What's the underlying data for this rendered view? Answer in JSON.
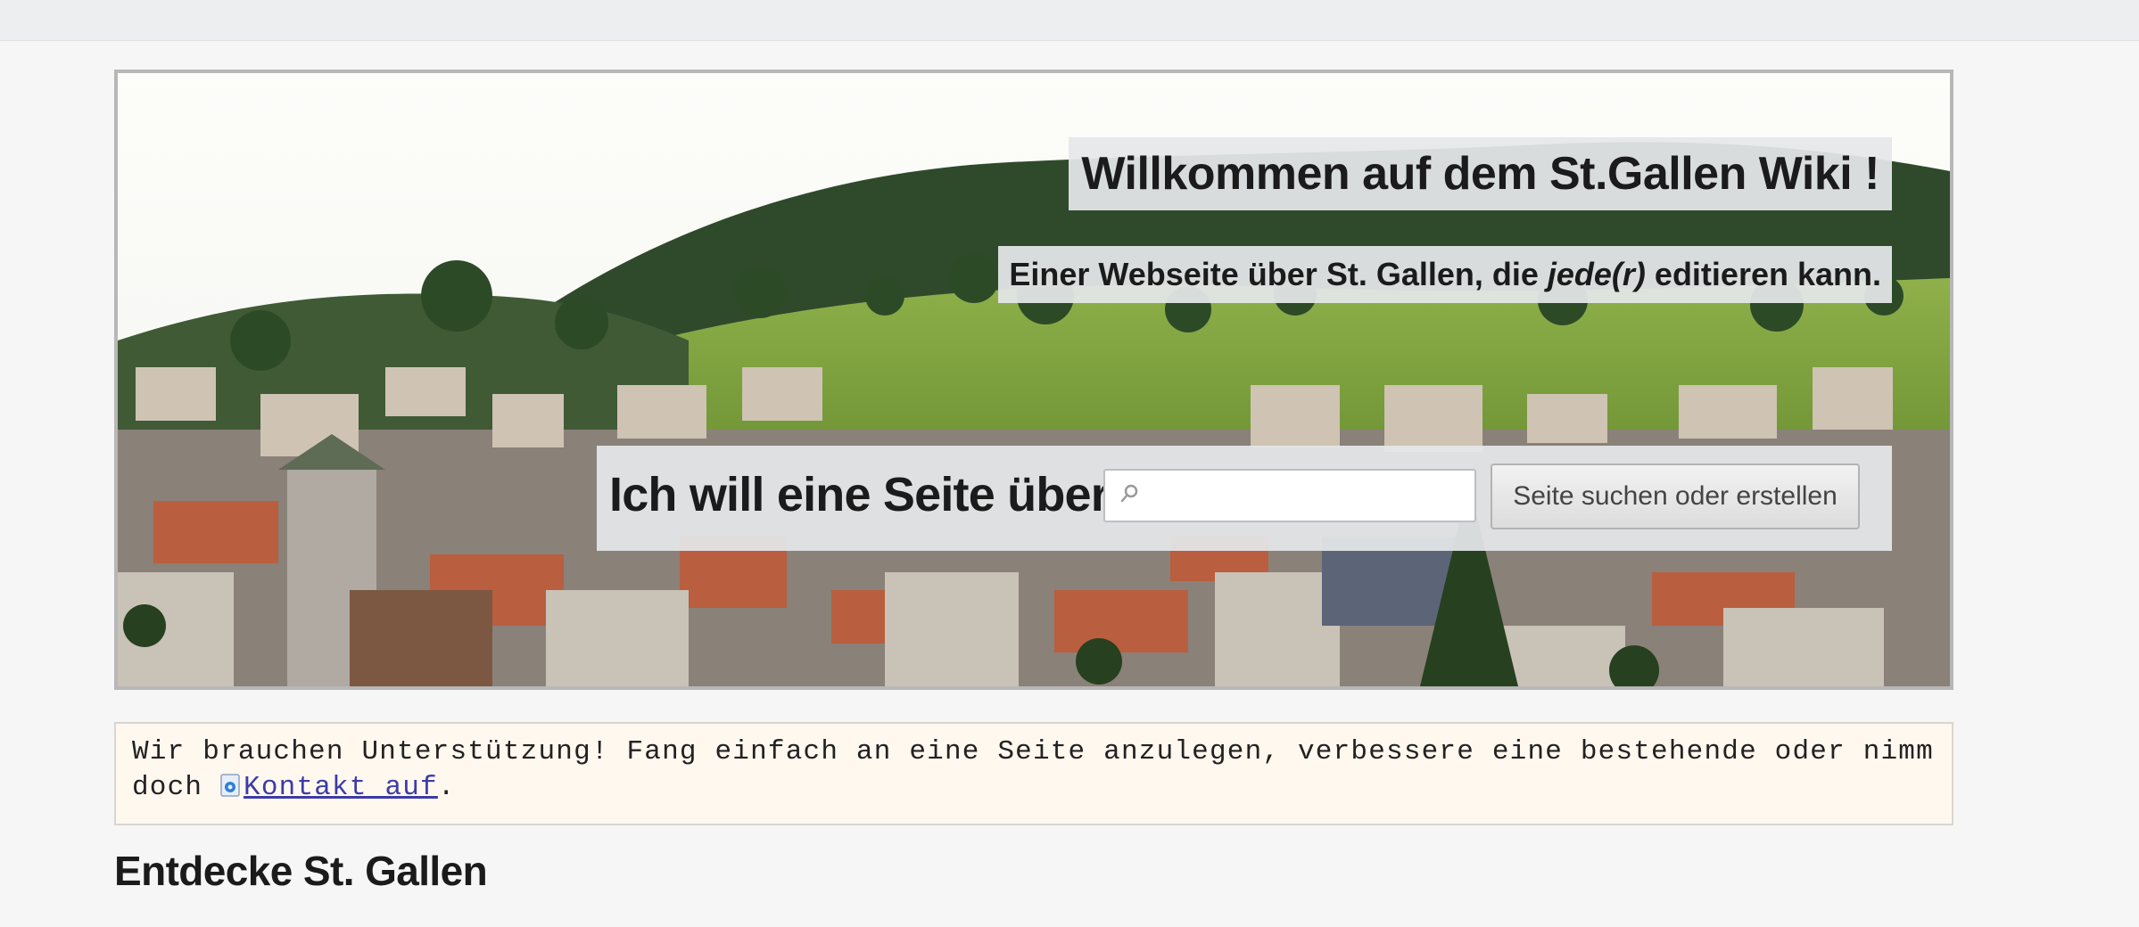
{
  "hero": {
    "title": "Willkommen auf dem St.Gallen Wiki !",
    "subtitle_before": "Einer Webseite über St. Gallen, die",
    "subtitle_emphasis": "jede(r)",
    "subtitle_after": "editieren kann.",
    "search_label": "Ich will eine Seite über",
    "search_value": "",
    "search_button_label": "Seite suchen oder erstellen",
    "search_icon": "search-icon"
  },
  "notice": {
    "text_before": "Wir brauchen Unterstützung! Fang einfach an eine Seite anzulegen, verbessere eine bestehende oder nimm doch",
    "link_label": "Kontakt auf",
    "text_after": ".",
    "link_icon": "mail-icon"
  },
  "main": {
    "section_heading": "Entdecke St. Gallen"
  },
  "colors": {
    "notice_background": "#fff8ef",
    "link": "#3b3ca8",
    "overlay": "#e5e7ea"
  }
}
